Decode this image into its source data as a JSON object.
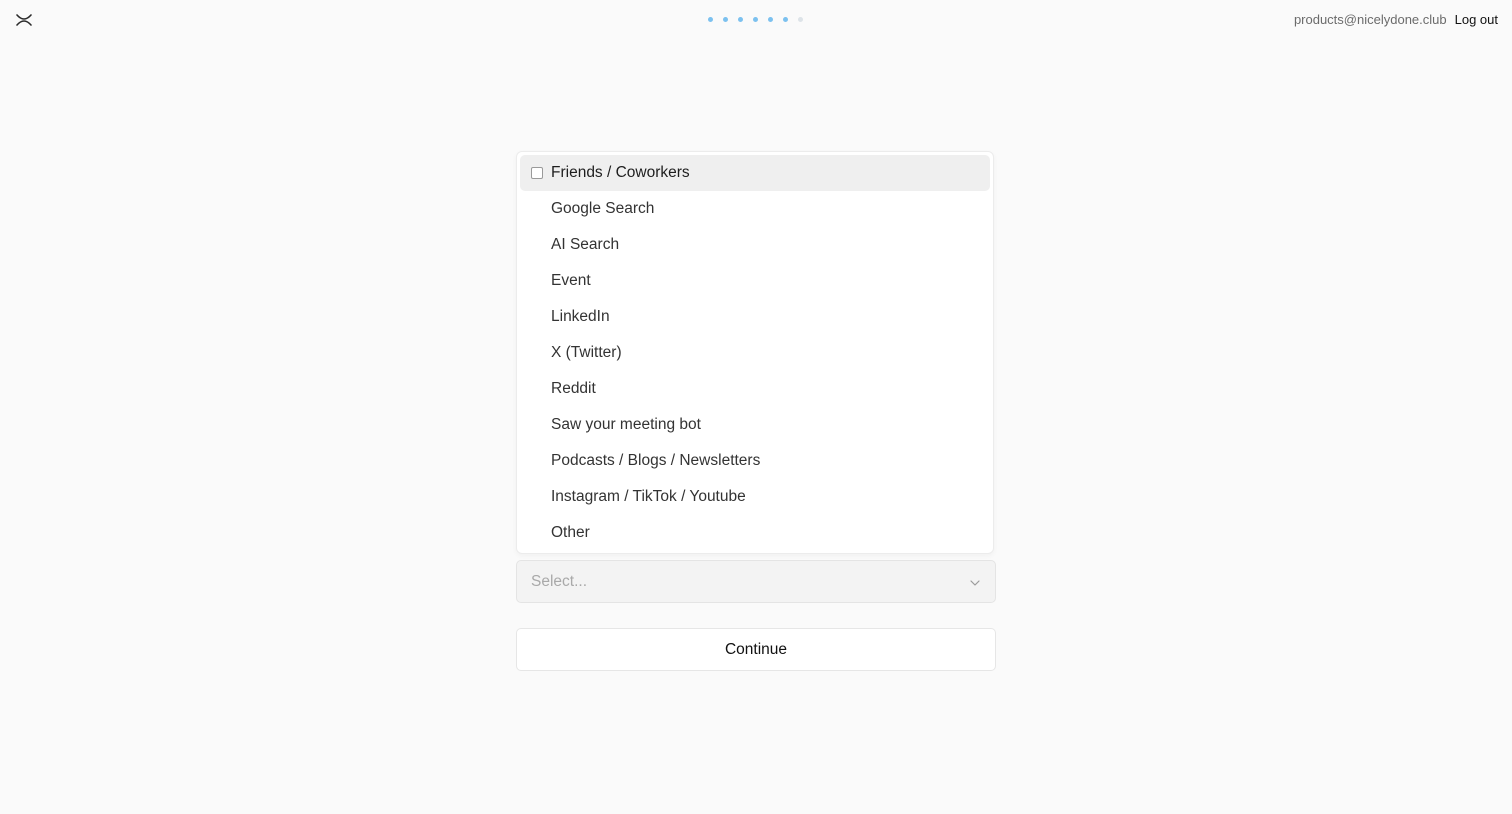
{
  "header": {
    "account_email": "products@nicelydone.club",
    "logout_label": "Log out",
    "progress": {
      "total_steps": 7,
      "completed_steps": 6,
      "active_color": "#7cc1ef",
      "inactive_color": "#dde3e8"
    }
  },
  "dropdown": {
    "options": [
      {
        "label": "Friends / Coworkers",
        "highlighted": true,
        "checked": false
      },
      {
        "label": "Google Search"
      },
      {
        "label": "AI Search"
      },
      {
        "label": "Event"
      },
      {
        "label": "LinkedIn"
      },
      {
        "label": "X (Twitter)"
      },
      {
        "label": "Reddit"
      },
      {
        "label": "Saw your meeting bot"
      },
      {
        "label": "Podcasts / Blogs / Newsletters"
      },
      {
        "label": "Instagram / TikTok / Youtube"
      },
      {
        "label": "Other"
      }
    ]
  },
  "select": {
    "placeholder": "Select...",
    "icon": "chevron-down-icon"
  },
  "actions": {
    "continue_label": "Continue"
  }
}
